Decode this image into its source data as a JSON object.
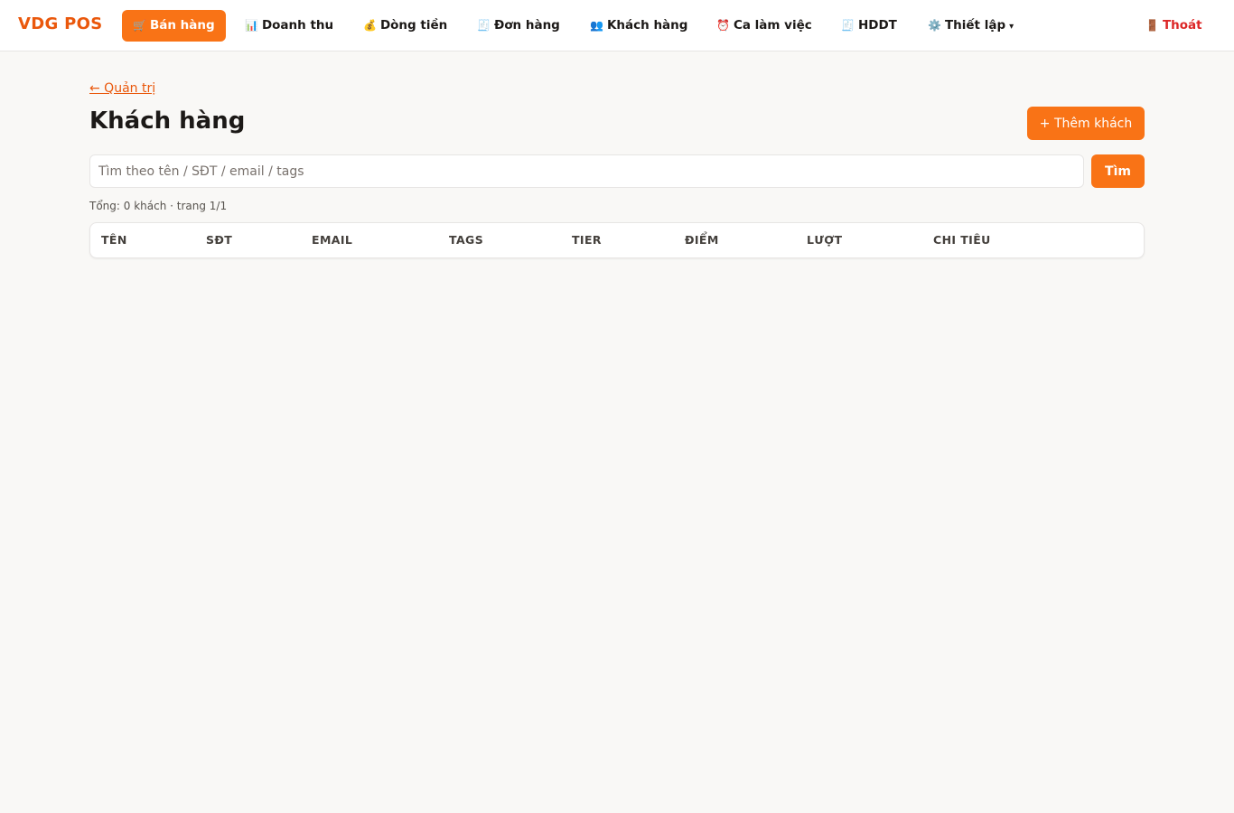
{
  "brand": "VDG POS",
  "nav": {
    "items": [
      {
        "icon": "🛒",
        "label": "Bán hàng"
      },
      {
        "icon": "📊",
        "label": "Doanh thu"
      },
      {
        "icon": "💰",
        "label": "Dòng tiền"
      },
      {
        "icon": "🧾",
        "label": "Đơn hàng"
      },
      {
        "icon": "👥",
        "label": "Khách hàng"
      },
      {
        "icon": "⏰",
        "label": "Ca làm việc"
      },
      {
        "icon": "🧾",
        "label": "HDDT"
      },
      {
        "icon": "⚙️",
        "label": "Thiết lập",
        "caret": "▾"
      }
    ],
    "logout": {
      "icon": "🚪",
      "label": "Thoát"
    }
  },
  "page": {
    "back_link": "← Quản trị",
    "title": "Khách hàng",
    "add_button": "+ Thêm khách",
    "search_placeholder": "Tìm theo tên / SĐT / email / tags",
    "search_value": "",
    "search_button": "Tìm",
    "summary": "Tổng: 0 khách · trang 1/1"
  },
  "table": {
    "columns": [
      "TÊN",
      "SĐT",
      "EMAIL",
      "TAGS",
      "TIER",
      "ĐIỂM",
      "LƯỢT",
      "CHI TIÊU"
    ],
    "rows": []
  },
  "colors": {
    "accent": "#f97316",
    "brand": "#ea580c",
    "logout": "#dc2626",
    "background": "#f9f8f6"
  }
}
